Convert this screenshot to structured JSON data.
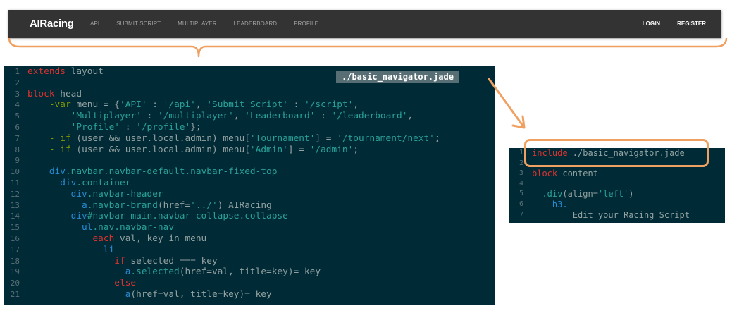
{
  "navbar": {
    "brand": "AIRacing",
    "links": [
      "API",
      "SUBMIT SCRIPT",
      "MULTIPLAYER",
      "LEADERBOARD",
      "PROFILE"
    ],
    "right_links": [
      "LOGIN",
      "REGISTER"
    ]
  },
  "accent_color": "#f0a060",
  "code_filename": "./basic_navigator.jade",
  "main_code": [
    {
      "n": "1",
      "segs": [
        [
          "kw",
          "extends"
        ],
        [
          "pl",
          " layout"
        ]
      ]
    },
    {
      "n": "2",
      "segs": []
    },
    {
      "n": "3",
      "segs": [
        [
          "kw",
          "block"
        ],
        [
          "pl",
          " head"
        ]
      ]
    },
    {
      "n": "4",
      "segs": [
        [
          "pl",
          "    "
        ],
        [
          "op",
          "-var"
        ],
        [
          "pl",
          " menu = {"
        ],
        [
          "str",
          "'API'"
        ],
        [
          "pl",
          " : "
        ],
        [
          "str",
          "'/api'"
        ],
        [
          "pl",
          ", "
        ],
        [
          "str",
          "'Submit Script'"
        ],
        [
          "pl",
          " : "
        ],
        [
          "str",
          "'/script'"
        ],
        [
          "pl",
          ","
        ]
      ]
    },
    {
      "n": "5",
      "segs": [
        [
          "pl",
          "        "
        ],
        [
          "str",
          "'Multiplayer'"
        ],
        [
          "pl",
          " : "
        ],
        [
          "str",
          "'/multiplayer'"
        ],
        [
          "pl",
          ", "
        ],
        [
          "str",
          "'Leaderboard'"
        ],
        [
          "pl",
          " : "
        ],
        [
          "str",
          "'/leaderboard'"
        ],
        [
          "pl",
          ","
        ]
      ]
    },
    {
      "n": "6",
      "segs": [
        [
          "pl",
          "        "
        ],
        [
          "str",
          "'Profile'"
        ],
        [
          "pl",
          " : "
        ],
        [
          "str",
          "'/profile'"
        ],
        [
          "pl",
          "};"
        ]
      ]
    },
    {
      "n": "7",
      "segs": [
        [
          "pl",
          "    "
        ],
        [
          "op",
          "- if"
        ],
        [
          "pl",
          " (user && user.local.admin) menu["
        ],
        [
          "str",
          "'Tournament'"
        ],
        [
          "pl",
          "] = "
        ],
        [
          "str",
          "'/tournament/next'"
        ],
        [
          "pl",
          ";"
        ]
      ]
    },
    {
      "n": "8",
      "segs": [
        [
          "pl",
          "    "
        ],
        [
          "op",
          "- if"
        ],
        [
          "pl",
          " (user && user.local.admin) menu["
        ],
        [
          "str",
          "'Admin'"
        ],
        [
          "pl",
          "] = "
        ],
        [
          "str",
          "'/admin'"
        ],
        [
          "pl",
          ";"
        ]
      ]
    },
    {
      "n": "9",
      "segs": []
    },
    {
      "n": "10",
      "segs": [
        [
          "pl",
          "    "
        ],
        [
          "tag",
          "div"
        ],
        [
          "cls",
          ".navbar.navbar-default.navbar-fixed-top"
        ]
      ]
    },
    {
      "n": "11",
      "segs": [
        [
          "pl",
          "      "
        ],
        [
          "tag",
          "div"
        ],
        [
          "cls",
          ".container"
        ]
      ]
    },
    {
      "n": "12",
      "segs": [
        [
          "pl",
          "        "
        ],
        [
          "tag",
          "div"
        ],
        [
          "cls",
          ".navbar-header"
        ]
      ]
    },
    {
      "n": "13",
      "segs": [
        [
          "pl",
          "          "
        ],
        [
          "tag",
          "a"
        ],
        [
          "cls",
          ".navbar-brand"
        ],
        [
          "pl",
          "(href="
        ],
        [
          "str",
          "'../'"
        ],
        [
          "pl",
          ") AIRacing"
        ]
      ]
    },
    {
      "n": "14",
      "segs": [
        [
          "pl",
          "        "
        ],
        [
          "tag",
          "div"
        ],
        [
          "cls",
          "#navbar-main.navbar-collapse.collapse"
        ]
      ]
    },
    {
      "n": "15",
      "segs": [
        [
          "pl",
          "          "
        ],
        [
          "tag",
          "ul"
        ],
        [
          "cls",
          ".nav.navbar-nav"
        ]
      ]
    },
    {
      "n": "16",
      "segs": [
        [
          "pl",
          "            "
        ],
        [
          "kw",
          "each"
        ],
        [
          "pl",
          " val, key in menu"
        ]
      ]
    },
    {
      "n": "17",
      "segs": [
        [
          "pl",
          "              "
        ],
        [
          "tag",
          "li"
        ]
      ]
    },
    {
      "n": "18",
      "segs": [
        [
          "pl",
          "                "
        ],
        [
          "kw",
          "if"
        ],
        [
          "pl",
          " selected === key"
        ]
      ]
    },
    {
      "n": "19",
      "segs": [
        [
          "pl",
          "                  "
        ],
        [
          "tag",
          "a"
        ],
        [
          "cls",
          ".selected"
        ],
        [
          "pl",
          "(href=val, title=key)= key"
        ]
      ]
    },
    {
      "n": "20",
      "segs": [
        [
          "pl",
          "                "
        ],
        [
          "kw",
          "else"
        ]
      ]
    },
    {
      "n": "21",
      "segs": [
        [
          "pl",
          "                  "
        ],
        [
          "tag",
          "a"
        ],
        [
          "pl",
          "(href=val, title=key)= key"
        ]
      ]
    }
  ],
  "small_code": [
    {
      "n": "1",
      "segs": [
        [
          "kw",
          "include"
        ],
        [
          "pl",
          " ./basic_navigator.jade"
        ]
      ]
    },
    {
      "n": "2",
      "segs": []
    },
    {
      "n": "3",
      "segs": [
        [
          "kw",
          "block"
        ],
        [
          "pl",
          " content"
        ]
      ]
    },
    {
      "n": "4",
      "segs": []
    },
    {
      "n": "5",
      "segs": [
        [
          "pl",
          "  "
        ],
        [
          "cls",
          ".div"
        ],
        [
          "pl",
          "(align="
        ],
        [
          "str",
          "'left'"
        ],
        [
          "pl",
          ")"
        ]
      ]
    },
    {
      "n": "6",
      "segs": [
        [
          "pl",
          "    "
        ],
        [
          "tag",
          "h3."
        ]
      ]
    },
    {
      "n": "7",
      "segs": [
        [
          "pl",
          "        Edit your Racing Script"
        ]
      ]
    }
  ]
}
